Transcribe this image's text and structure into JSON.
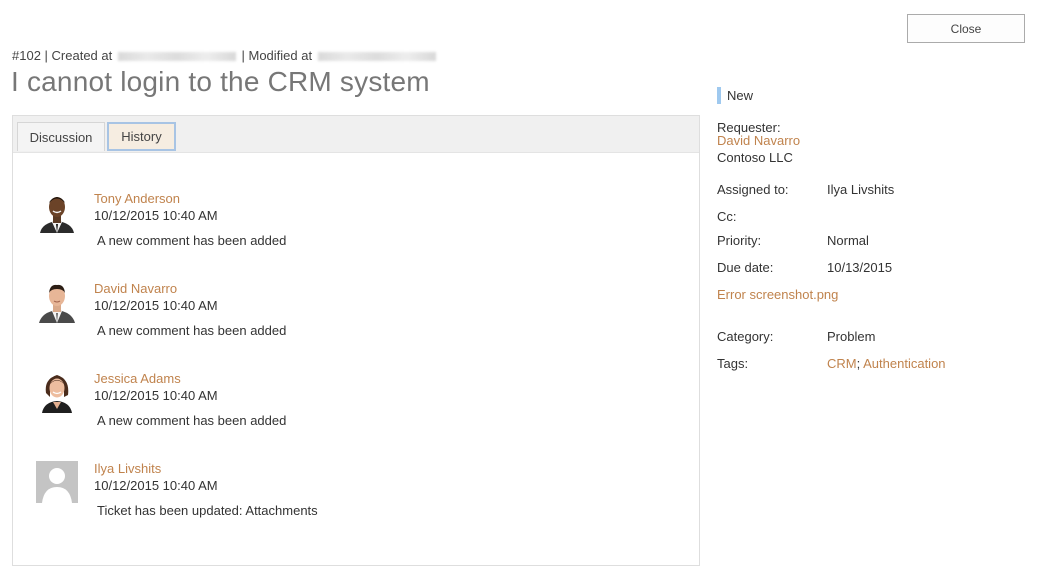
{
  "toolbar": {
    "close_label": "Close"
  },
  "ticket": {
    "number": "#102",
    "created_label": "| Created at",
    "modified_label": "| Modified at",
    "title": "I cannot login to the CRM system"
  },
  "tabs": [
    {
      "label": "Discussion",
      "active": false
    },
    {
      "label": "History",
      "active": true
    }
  ],
  "history": [
    {
      "author": "Tony Anderson",
      "date": "10/12/2015 10:40 AM",
      "text": "A new comment has been added",
      "avatar": "tony-anderson-avatar"
    },
    {
      "author": "David Navarro",
      "date": "10/12/2015 10:40 AM",
      "text": "A new comment has been added",
      "avatar": "david-navarro-avatar"
    },
    {
      "author": "Jessica Adams",
      "date": "10/12/2015 10:40 AM",
      "text": "A new comment has been added",
      "avatar": "jessica-adams-avatar"
    },
    {
      "author": "Ilya Livshits",
      "date": "10/12/2015 10:40 AM",
      "text": "Ticket has been updated: Attachments",
      "avatar": "default-user-avatar"
    }
  ],
  "details": {
    "status": "New",
    "status_color": "#9fc9ef",
    "requester_label": "Requester:",
    "requester_name": "David Navarro",
    "requester_company": "Contoso LLC",
    "assigned_label": "Assigned to:",
    "assigned_value": "Ilya Livshits",
    "cc_label": "Cc:",
    "priority_label": "Priority:",
    "priority_value": "Normal",
    "due_label": "Due date:",
    "due_value": "10/13/2015",
    "attachment": "Error screenshot.png",
    "category_label": "Category:",
    "category_value": "Problem",
    "tags_label": "Tags:",
    "tags": [
      "CRM",
      "Authentication"
    ],
    "tag_separator": ";"
  },
  "colors": {
    "link": "#c0834d",
    "title": "#777777",
    "history_tab_bg": "#f6ede1",
    "history_tab_border": "#a8c4e4"
  }
}
